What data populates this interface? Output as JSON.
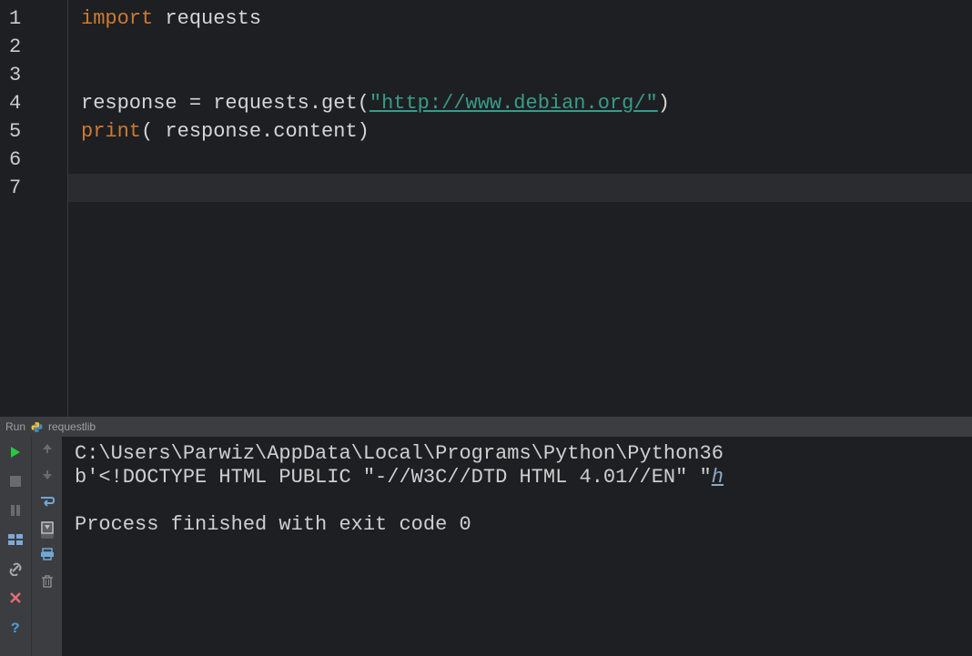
{
  "editor": {
    "line_numbers": [
      "1",
      "2",
      "3",
      "4",
      "5",
      "6",
      "7"
    ],
    "code": {
      "l1": {
        "kw": "import",
        "rest": " requests"
      },
      "l4": {
        "v": "response ",
        "eq": "= ",
        "call": "requests.get(",
        "str": "\"http://www.debian.org/\"",
        "close": ")"
      },
      "l5": {
        "fn": "print",
        "open": "(",
        "hint": " ",
        "arg": "response.content",
        "close": ")"
      }
    },
    "current_line": 7
  },
  "run": {
    "header_label": "Run",
    "config_name": "requestlib",
    "console_lines": {
      "l1": "C:\\Users\\Parwiz\\AppData\\Local\\Programs\\Python\\Python36",
      "l2a": "b'<!DOCTYPE HTML PUBLIC \"-//W3C//DTD HTML 4.01//EN\" \"",
      "l2b": "h",
      "l3": "",
      "l4": "Process finished with exit code 0"
    }
  },
  "colors": {
    "background": "#1e1f22",
    "keyword": "#cc7a32",
    "string": "#379c8a",
    "text": "#d6d6d6"
  }
}
